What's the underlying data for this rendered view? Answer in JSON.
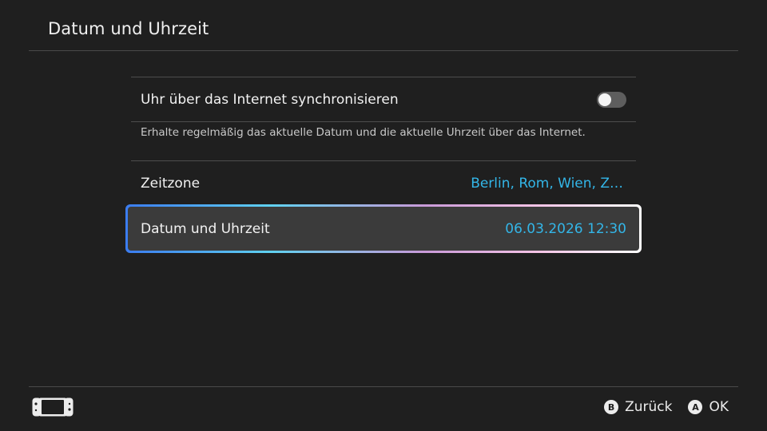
{
  "header": {
    "title": "Datum und Uhrzeit"
  },
  "settings": {
    "sync": {
      "label": "Uhr über das Internet synchronisieren",
      "enabled": false,
      "description": "Erhalte regelmäßig das aktuelle Datum und die aktuelle Uhrzeit über das Internet."
    },
    "timezone": {
      "label": "Zeitzone",
      "value": "Berlin, Rom, Wien, Z…"
    },
    "datetime": {
      "label": "Datum und Uhrzeit",
      "value": "06.03.2026 12:30",
      "selected": true
    }
  },
  "footer": {
    "device_icon": "handheld-console-icon",
    "back": {
      "button": "B",
      "label": "Zurück"
    },
    "ok": {
      "button": "A",
      "label": "OK"
    }
  },
  "colors": {
    "background": "#1f1f1f",
    "accent_value": "#33b6e8",
    "toggle_off": "#5e5e5e",
    "selected_row": "#3b3b3b"
  }
}
